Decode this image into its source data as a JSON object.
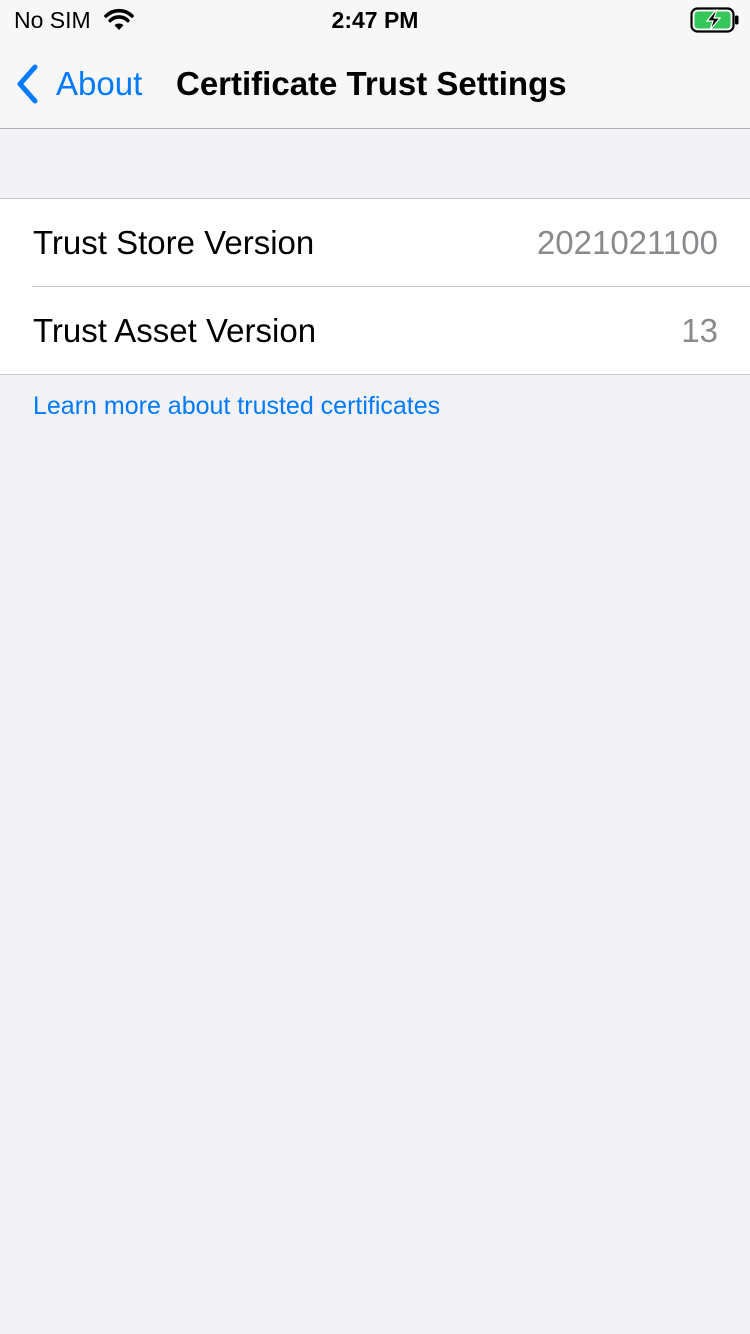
{
  "status_bar": {
    "carrier": "No SIM",
    "time": "2:47 PM",
    "wifi_icon": "wifi-icon",
    "battery_icon": "battery-charging-icon",
    "battery_color": "#34C759"
  },
  "nav": {
    "back_label": "About",
    "back_icon": "chevron-left-icon",
    "title": "Certificate Trust Settings"
  },
  "rows": [
    {
      "label": "Trust Store Version",
      "value": "2021021100"
    },
    {
      "label": "Trust Asset Version",
      "value": "13"
    }
  ],
  "footer": {
    "link_text": "Learn more about trusted certificates"
  },
  "colors": {
    "accent": "#007AFF",
    "background": "#F2F2F7",
    "secondary_text": "#8A8A8E"
  }
}
